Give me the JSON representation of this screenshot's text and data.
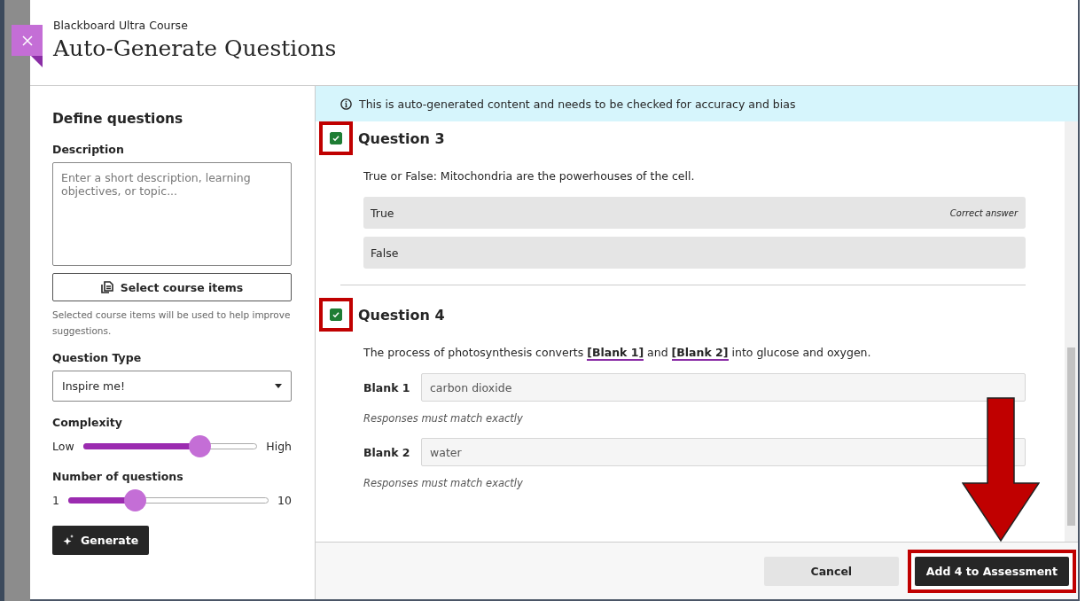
{
  "header": {
    "course": "Blackboard Ultra Course",
    "title": "Auto-Generate Questions"
  },
  "define": {
    "heading": "Define questions",
    "description_label": "Description",
    "description_placeholder": "Enter a short description, learning objectives, or topic...",
    "select_button": "Select course items",
    "select_note": "Selected course items will be used to help improve suggestions.",
    "type_label": "Question Type",
    "type_value": "Inspire me!",
    "sliders": [
      {
        "label": "Complexity",
        "min_label": "Low",
        "max_label": "High",
        "level": 0.67
      },
      {
        "label": "Number of questions",
        "min_label": "1",
        "max_label": "10",
        "level": 0.33
      }
    ],
    "generate": "Generate"
  },
  "notice": "This is auto-generated content and needs to be checked for accuracy and bias",
  "questions": [
    {
      "kind": "true_false",
      "title": "Question 3",
      "checked": true,
      "prompt": "True or False: Mitochondria are the powerhouses of the cell.",
      "options": [
        {
          "text": "True",
          "note": "Correct answer"
        },
        {
          "text": "False"
        }
      ]
    },
    {
      "kind": "fill_blank",
      "title": "Question 4",
      "checked": true,
      "prompt": "The process of photosynthesis converts **[Blank 1]** and **[Blank 2]** into glucose and oxygen.",
      "blanks": [
        {
          "label": "Blank 1",
          "value": "carbon dioxide",
          "hint": "Responses must match exactly"
        },
        {
          "label": "Blank 2",
          "value": "water",
          "hint": "Responses must match exactly"
        }
      ]
    }
  ],
  "footer": {
    "cancel": "Cancel",
    "submit": "Add 4 to Assessment"
  }
}
